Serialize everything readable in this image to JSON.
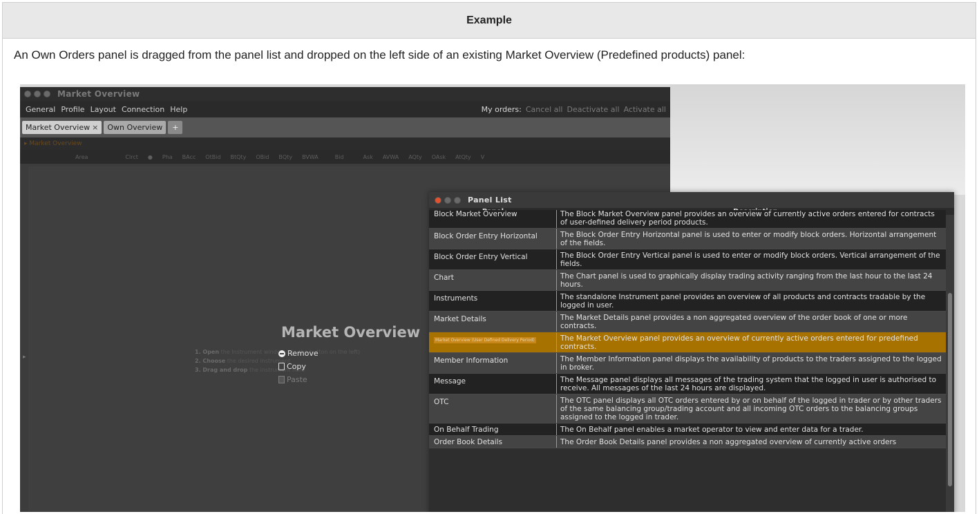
{
  "example_header": "Example",
  "intro_text": "An Own Orders panel is dragged from the panel list and dropped on the left side of an existing Market Overview (Predefined products) panel:",
  "app": {
    "window_title": "Market Overview",
    "menu": [
      "General",
      "Profile",
      "Layout",
      "Connection",
      "Help"
    ],
    "my_orders_label": "My orders:",
    "my_orders_actions": [
      "Cancel all",
      "Deactivate all",
      "Activate all"
    ],
    "tabs": [
      {
        "label": "Market Overview",
        "close": "×"
      },
      {
        "label": "Own Overview"
      }
    ],
    "add_tab": "+",
    "subbar": "▸ Market Overview",
    "columns": [
      "Area",
      "Clrct",
      "●",
      "Pha",
      "BAcc",
      "OtBid",
      "BtQty",
      "OBid",
      "BQty",
      "BVWA",
      "Bid",
      "Ask",
      "AVWA",
      "AQty",
      "OAsk",
      "AtQty",
      "Ⅴ"
    ],
    "center_title": "Market Overview",
    "steps": [
      {
        "bold": "1. Open",
        "rest": "the Instrument window (via the button on the left)"
      },
      {
        "bold": "2. Choose",
        "rest": "the desired instrument"
      },
      {
        "bold": "3. Drag and drop",
        "rest": "the instrument here"
      }
    ],
    "context_menu": {
      "remove": "Remove",
      "copy": "Copy",
      "paste": "Paste"
    },
    "side_handle": "▸"
  },
  "panel_list": {
    "title": "Panel List",
    "header_panel": "Panel",
    "header_description": "Description",
    "rows": [
      {
        "panel": "Block Market Overview",
        "desc": "The Block Market Overview panel provides an overview of currently active orders entered for contracts of user-defined delivery period products."
      },
      {
        "panel": "Block Order Entry Horizontal",
        "desc": "The Block Order Entry Horizontal panel is used to enter or modify block orders. Horizontal arrangement of the fields."
      },
      {
        "panel": "Block Order Entry Vertical",
        "desc": "The Block Order Entry Vertical panel is used to enter or modify block orders. Vertical arrangement of the fields."
      },
      {
        "panel": "Chart",
        "desc": "The Chart panel is used to graphically display trading activity ranging from the last hour to the last 24 hours."
      },
      {
        "panel": "Instruments",
        "desc": "The standalone Instrument panel provides an overview of all products and contracts tradable by the logged in user."
      },
      {
        "panel": "Market Details",
        "desc": "The Market Details panel provides a non aggregated overview of the order book of one or more contracts."
      },
      {
        "panel": "Market Overview (User Defined Delivery Period)",
        "desc": "The Market Overview panel provides an overview of currently active orders entered for predefined contracts.",
        "selected": true
      },
      {
        "panel": "Member Information",
        "desc": "The Member Information panel displays the availability of products to the traders assigned to the logged in broker."
      },
      {
        "panel": "Message",
        "desc": "The Message panel displays all messages of the trading system that the logged in user is authorised to receive. All messages of the last 24 hours are displayed."
      },
      {
        "panel": "OTC",
        "desc": "The OTC panel displays all OTC orders entered by or on behalf of the logged in trader or by other traders of the same balancing group/trading account and all incoming OTC orders to the balancing groups assigned to the logged in trader."
      },
      {
        "panel": "On Behalf Trading",
        "desc": "The On Behalf panel enables a market operator to view and enter data for a trader."
      },
      {
        "panel": "Order Book Details",
        "desc": "The Order Book Details panel provides a non aggregated overview of currently active orders"
      }
    ]
  },
  "colors": {
    "selection": "#a87200",
    "app_bg": "#3c3c3c",
    "close_dot": "#e2522e"
  }
}
